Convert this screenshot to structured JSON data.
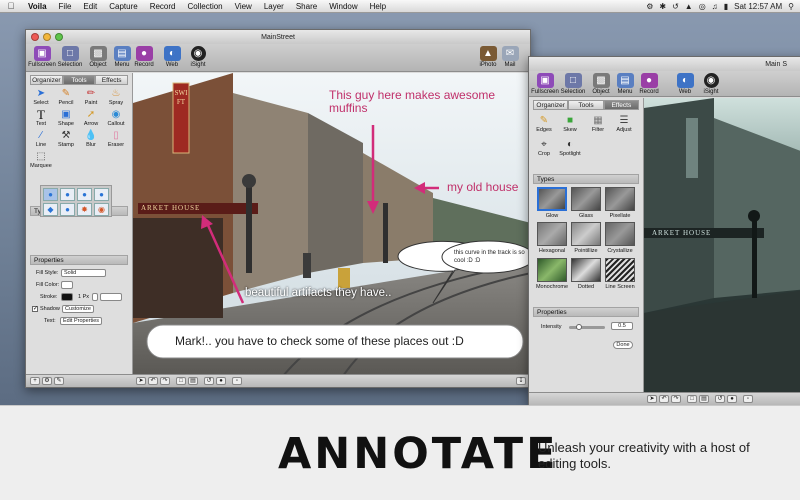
{
  "menubar": {
    "items": [
      "Voila",
      "File",
      "Edit",
      "Capture",
      "Record",
      "Collection",
      "View",
      "Layer",
      "Share",
      "Window",
      "Help"
    ],
    "clock": "Sat 12:57 AM"
  },
  "main_window": {
    "title": "MainStreet",
    "toolbar_left": [
      "Fullscreen",
      "Selection",
      "Object",
      "Menu",
      "Record",
      "Web",
      "iSight"
    ],
    "toolbar_right": [
      "iPhoto",
      "Mail"
    ],
    "tabs": [
      "Organizer",
      "Tools",
      "Effects"
    ],
    "active_tab": "Tools",
    "tools": [
      "Select",
      "Pencil",
      "Paint",
      "Spray",
      "Text",
      "Shape",
      "Arrow",
      "Callout",
      "Line",
      "Stamp",
      "Blur",
      "Eraser",
      "Marquee"
    ],
    "sections": {
      "types": "Types",
      "properties": "Properties"
    },
    "properties": {
      "fill_style_label": "Fill Style:",
      "fill_style_value": "Solid",
      "fill_color_label": "Fill Color:",
      "stroke_label": "Stroke:",
      "stroke_value": "1 Px",
      "shadow_label": "Shadow",
      "customize_button": "Customize",
      "text_label": "Text:",
      "edit_properties_button": "Edit Properties"
    }
  },
  "canvas": {
    "sign_swift": "SWIFT",
    "sign_market": "ARKET HOUSE"
  },
  "annotations": {
    "muffins": "This guy here makes awesome muffins",
    "old_house": "my old house",
    "curve": "this curve in the track is so cool :D :D",
    "artifacts": "beautiful artifacts they have..",
    "mark": "Mark!.. you have to check some of these places out :D"
  },
  "effects_window": {
    "title": "Main S",
    "toolbar": [
      "Fullscreen",
      "Selection",
      "Object",
      "Menu",
      "Record",
      "Web",
      "iSight"
    ],
    "tabs": [
      "Organizer",
      "Tools",
      "Effects"
    ],
    "active_tab": "Effects",
    "effects": [
      "Edges",
      "Skew",
      "Filter",
      "Adjust",
      "Crop",
      "Spotlight"
    ],
    "types_section": "Types",
    "types": [
      "Glow",
      "Glass",
      "Pixellate",
      "Hexagonal",
      "Pointillize",
      "Crystallize",
      "Monochrome",
      "Dotted",
      "Line Screen"
    ],
    "selected_type": "Glow",
    "properties_section": "Properties",
    "intensity_label": "Intensity",
    "intensity_value": "0.5",
    "intensity_fraction": 0.2,
    "done_button": "Done"
  },
  "footer": {
    "title": "ANNOTATE",
    "tagline": "Unleash your creativity with a host of editing tools."
  },
  "colors": {
    "annotation_pink": "#c0306a",
    "selection_blue": "#2a6fd6"
  }
}
